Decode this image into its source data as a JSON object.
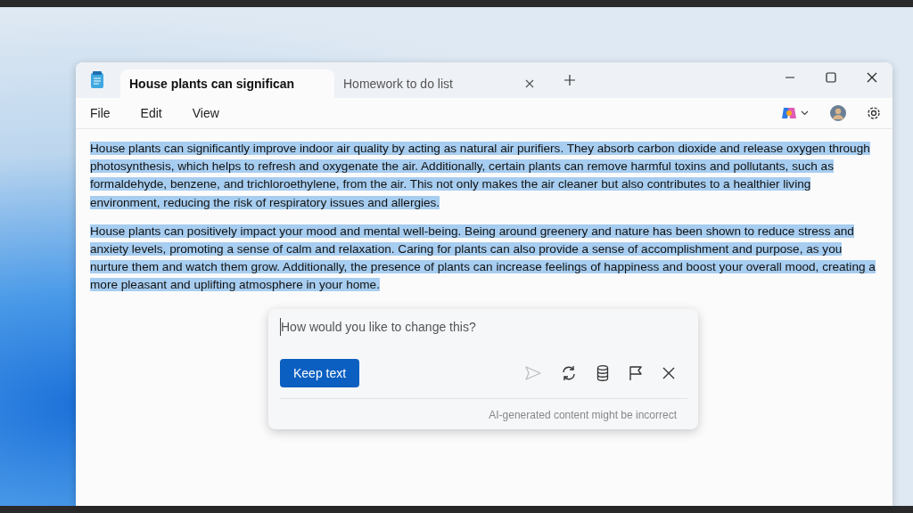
{
  "tabs": [
    {
      "label": "House plants can significan",
      "selected": true
    },
    {
      "label": "Homework to do list",
      "selected": false
    }
  ],
  "menu": [
    "File",
    "Edit",
    "View"
  ],
  "document": {
    "paragraphs": [
      {
        "text": "House plants can significantly improve indoor air quality by acting as natural air purifiers. They absorb carbon dioxide and release oxygen through photosynthesis, which helps to refresh and oxygenate the air. Additionally, certain plants can remove harmful toxins and pollutants, such as formaldehyde, benzene, and trichloroethylene, from the air. This not only makes the air cleaner but also contributes to a healthier living environment, reducing the risk of respiratory issues and allergies.",
        "selected": true
      },
      {
        "text": "House plants can positively impact your mood and mental well-being. Being around greenery and nature has been shown to reduce stress and anxiety levels, promoting a sense of calm and relaxation. Caring for plants can also provide a sense of accomplishment and purpose, as you nurture them and watch them grow. Additionally, the presence of plants can increase feelings of happiness and boost your overall mood, creating a more pleasant and uplifting atmosphere in your home.",
        "selected": true
      }
    ]
  },
  "rewrite_popup": {
    "placeholder": "How would you like to change this?",
    "keep_button": "Keep text",
    "actions": [
      {
        "kind": "send",
        "disabled": true
      },
      {
        "kind": "regenerate",
        "disabled": false
      },
      {
        "kind": "stack",
        "disabled": false
      },
      {
        "kind": "flag",
        "disabled": false
      },
      {
        "kind": "close",
        "disabled": false
      }
    ],
    "disclaimer": "AI-generated content might be incorrect"
  }
}
